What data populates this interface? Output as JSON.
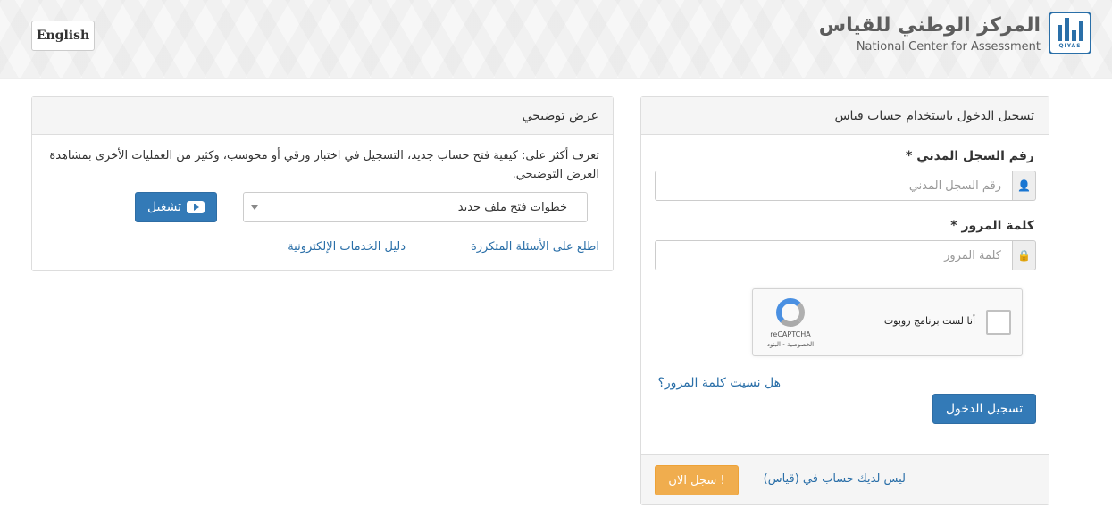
{
  "header": {
    "language_button": "English",
    "brand_ar": "المركز الوطني للقياس",
    "brand_en": "National Center for Assessment",
    "logo_text": "QIYAS"
  },
  "login": {
    "title": "تسجيل الدخول باستخدام حساب قياس",
    "id_label": "رقم السجل المدني *",
    "id_placeholder": "رقم السجل المدني",
    "password_label": "كلمة المرور *",
    "password_placeholder": "كلمة المرور",
    "captcha": {
      "label": "أنا لست برنامج روبوت",
      "brand": "reCAPTCHA",
      "links": "الخصوصية - البنود"
    },
    "forgot_password": "هل نسيت كلمة المرور؟",
    "login_button": "تسجيل الدخول",
    "no_account_text": "ليس لديك حساب في (قياس)",
    "register_button": "سجل الان !"
  },
  "demo": {
    "title": "عرض توضيحي",
    "description": "تعرف أكثر على: كيفية فتح حساب جديد، التسجيل في اختبار ورقي أو محوسب، وكثير من العمليات الأخرى بمشاهدة العرض التوضيحي.",
    "select_value": "خطوات فتح ملف جديد",
    "play_button": "تشغيل",
    "faq_link": "اطلع على الأسئلة المتكررة",
    "guide_link": "دليل الخدمات الإلكترونية"
  },
  "colors": {
    "primary": "#337ab7",
    "warning": "#f0ad4e",
    "link": "#2a6fa8"
  }
}
